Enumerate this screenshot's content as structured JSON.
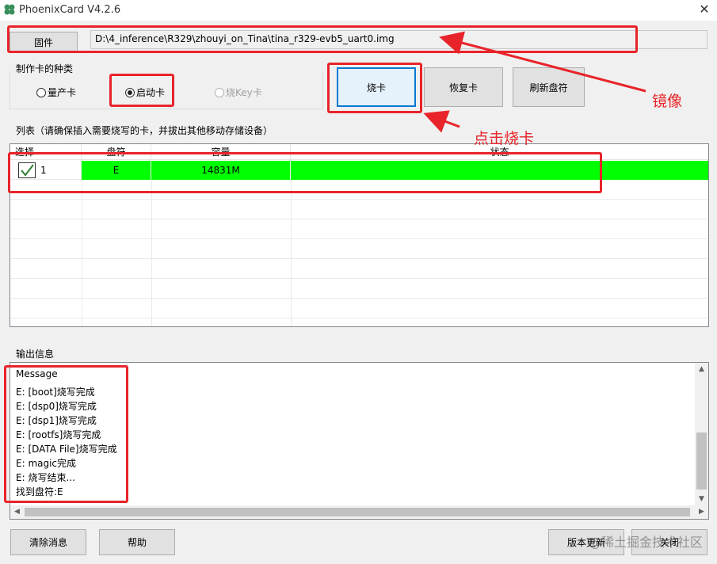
{
  "window": {
    "title": "PhoenixCard V4.2.6",
    "close_glyph": "✕"
  },
  "firmware": {
    "button_label": "固件",
    "path": "D:\\4_inference\\R329\\zhouyi_on_Tina\\tina_r329-evb5_uart0.img"
  },
  "card_type": {
    "group_label": "制作卡的种类",
    "options": [
      {
        "label": "量产卡",
        "selected": false,
        "enabled": true
      },
      {
        "label": "启动卡",
        "selected": true,
        "enabled": true
      },
      {
        "label": "烧Key卡",
        "selected": false,
        "enabled": false
      }
    ]
  },
  "actions": {
    "burn": "烧卡",
    "restore": "恢复卡",
    "refresh": "刷新盘符"
  },
  "list": {
    "group_label": "列表（请确保插入需要烧写的卡，并拔出其他移动存储设备）",
    "columns": [
      "选择",
      "盘符",
      "容量",
      "状态"
    ],
    "rows": [
      {
        "checked": true,
        "index": "1",
        "drive": "E",
        "capacity": "14831M",
        "status": "",
        "status_color": "#00ff00"
      }
    ]
  },
  "output": {
    "group_label": "输出信息",
    "lines": [
      "Message",
      "E: [boot]烧写完成",
      "E: [dsp0]烧写完成",
      "E: [dsp1]烧写完成",
      "E: [rootfs]烧写完成",
      "E: [DATA File]烧写完成",
      "E: magic完成",
      "E: 烧写结束...",
      "找到盘符:E"
    ]
  },
  "footer": {
    "clear": "清除消息",
    "help": "帮助",
    "update": "版本更新",
    "close": "关闭"
  },
  "annotations": {
    "image_label": "镜像",
    "click_label": "点击烧卡",
    "color": "#e8242a"
  },
  "watermark": "@稀土掘金技术社区"
}
